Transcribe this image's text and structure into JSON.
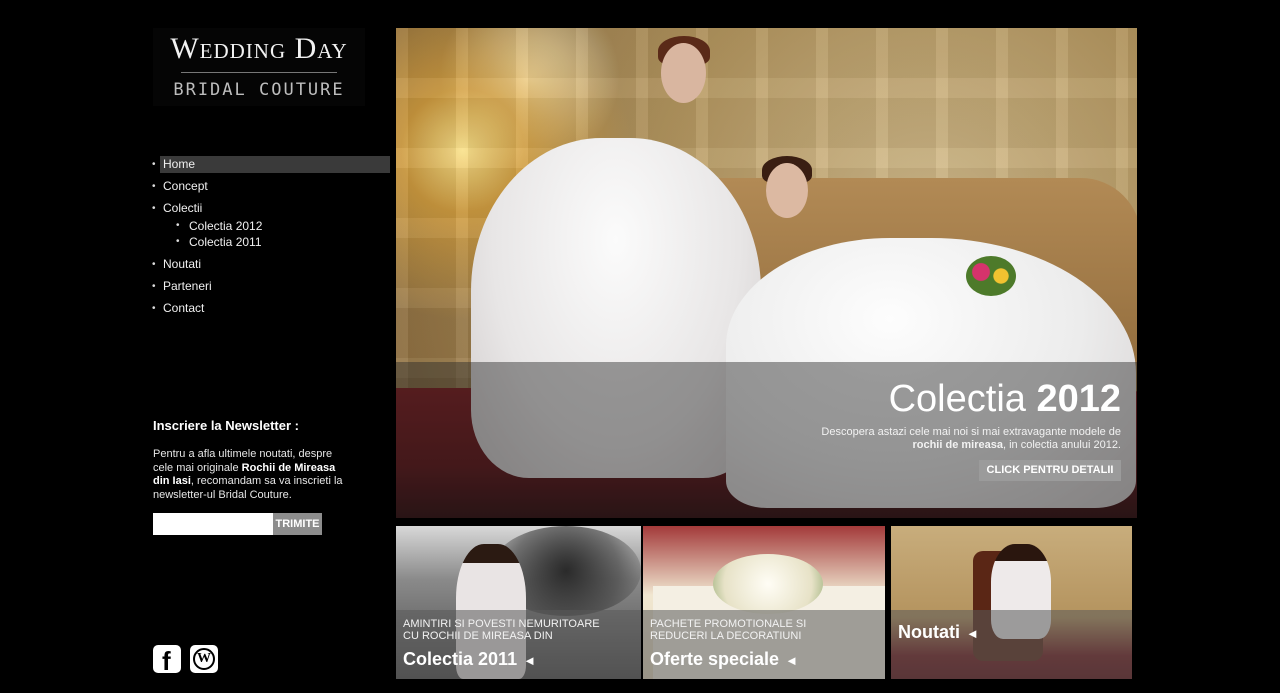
{
  "logo": {
    "top": "Wedding Day",
    "bottom": "BRIDAL COUTURE"
  },
  "nav": {
    "items": [
      {
        "label": "Home"
      },
      {
        "label": "Concept"
      },
      {
        "label": "Colectii",
        "children": [
          "Colectia 2012",
          "Colectia 2011"
        ]
      },
      {
        "label": "Noutati"
      },
      {
        "label": "Parteneri"
      },
      {
        "label": "Contact"
      }
    ],
    "active": "Home",
    "bullet": "•"
  },
  "newsletter": {
    "title": "Inscriere la Newsletter :",
    "text_1": "Pentru a afla ultimele noutati, despre cele mai originale ",
    "text_bold": "Rochii de Mireasa din Iasi",
    "text_2": ", recomandam sa va inscrieti la newsletter-ul Bridal Couture.",
    "input_value": "",
    "button": "TRIMITE"
  },
  "social": [
    {
      "icon": "facebook-icon",
      "glyph": "f"
    },
    {
      "icon": "wordpress-icon",
      "glyph": "W"
    }
  ],
  "hero": {
    "title_regular": "Colectia ",
    "title_bold": "2012",
    "desc_1": "Descopera astazi cele mai noi si mai extravagante modele de ",
    "desc_bold": "rochii de mireasa",
    "desc_2": ", in colectia anului 2012.",
    "button": "CLICK PENTRU DETALII"
  },
  "tiles": [
    {
      "subtitle": "AMINTIRI SI POVESTI NEMURITOARE CU ROCHII DE MIREASA DIN",
      "title": "Colectia 2011",
      "arrow": "◄"
    },
    {
      "subtitle": "PACHETE PROMOTIONALE SI REDUCERI LA DECORATIUNI",
      "title": "Oferte speciale",
      "arrow": "◄"
    },
    {
      "subtitle": "",
      "title": "Noutati",
      "arrow": "◄"
    }
  ],
  "colors": {
    "background": "#000000",
    "nav_active": "#3a3a3a",
    "button_gray": "#9b9b9b"
  }
}
